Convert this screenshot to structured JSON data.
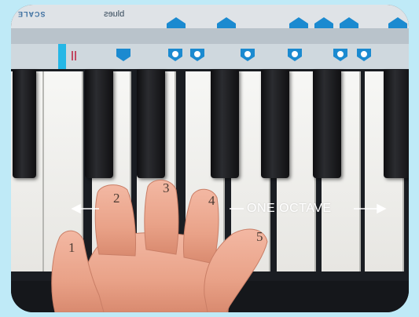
{
  "label_strip": {
    "top_text": "blues",
    "logo_text": "SCALE"
  },
  "finger_numbers": [
    "1",
    "2",
    "3",
    "4",
    "5"
  ],
  "octave_label": "ONE OCTAVE",
  "colors": {
    "background": "#bfeaf7",
    "marker_blue": "#1b8ad0",
    "label_white": "#ffffff"
  }
}
